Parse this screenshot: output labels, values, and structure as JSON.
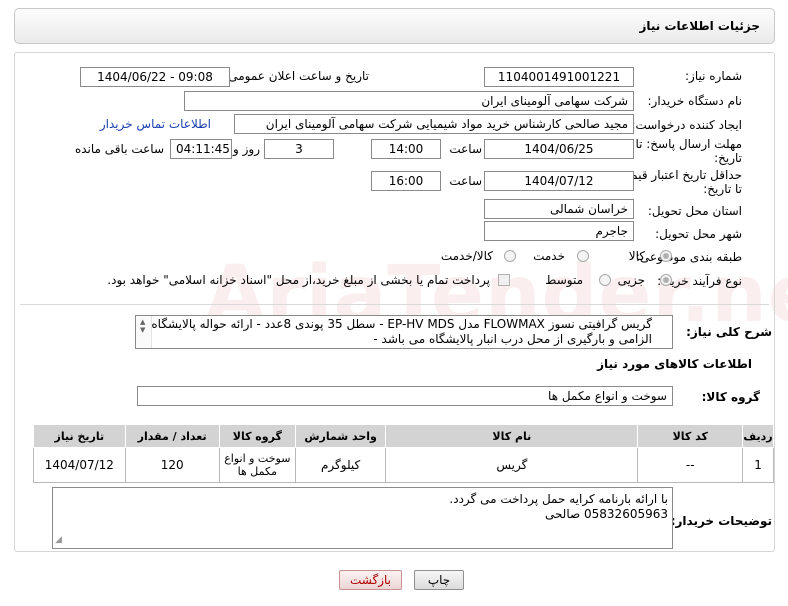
{
  "header": {
    "title": "جزئیات اطلاعات نیاز"
  },
  "watermark": "AriaTender.neT",
  "fields": {
    "need_number_label": "شماره نیاز:",
    "need_number": "1104001491001221",
    "announce_label": "تاریخ و ساعت اعلان عمومی:",
    "announce_value": "1404/06/22 - 09:08",
    "buyer_org_label": "نام دستگاه خریدار:",
    "buyer_org": "شرکت سهامی آلومینای ایران",
    "creator_label": "ایجاد کننده درخواست:",
    "creator": "مجید صالحی کارشناس خرید مواد شیمیایی شرکت سهامی آلومینای ایران",
    "contact_link": "اطلاعات تماس خریدار",
    "deadline_label_1": "مهلت ارسال پاسخ: تا",
    "deadline_label_2": "تاریخ:",
    "deadline_date": "1404/06/25",
    "time_label": "ساعت",
    "deadline_time": "14:00",
    "days_value": "3",
    "days_label": "روز و",
    "remaining_time": "04:11:45",
    "remaining_label": "ساعت باقی مانده",
    "price_label_1": "حداقل تاریخ اعتبار قیمت:",
    "price_label_2": "تا تاریخ:",
    "price_date": "1404/07/12",
    "price_time": "16:00",
    "province_label": "استان محل تحویل:",
    "province": "خراسان شمالی",
    "city_label": "شهر محل تحویل:",
    "city": "جاجرم",
    "category_label": "طبقه بندی موضوعی:",
    "category_options": [
      "کالا",
      "خدمت",
      "کالا/خدمت"
    ],
    "process_label": "نوع فرآیند خرید :",
    "process_options": [
      "جزیی",
      "متوسط"
    ],
    "payment_note": "پرداخت تمام یا بخشی از مبلغ خرید،از محل \"اسناد خزانه اسلامی\" خواهد بود.",
    "description_label": "شرح کلی نیاز:",
    "description": "گریس گرافیتی نسوز FLOWMAX مدل EP-HV MDS - سطل 35 پوندی 8عدد - ارائه حواله پالایشگاه الزامی و بارگیری از محل درب انبار پالایشگاه می باشد -",
    "goods_info_title": "اطلاعات کالاهای مورد نیاز",
    "goods_group_label": "گروه کالا:",
    "goods_group": "سوخت و انواع مکمل ها",
    "buyer_notes_label": "توضیحات خریدار:",
    "buyer_notes_line1": "با ارائه بارنامه کرایه حمل پرداخت می گردد.",
    "buyer_notes_line2": "05832605963 صالحی"
  },
  "table": {
    "headers": [
      "ردیف",
      "کد کالا",
      "نام کالا",
      "واحد شمارش",
      "گروه کالا",
      "تعداد / مقدار",
      "تاریخ نیاز"
    ],
    "rows": [
      [
        "1",
        "--",
        "گریس",
        "کیلوگرم",
        "سوخت و انواع مکمل ها",
        "120",
        "1404/07/12"
      ]
    ]
  },
  "buttons": {
    "print": "چاپ",
    "back": "بازگشت"
  }
}
